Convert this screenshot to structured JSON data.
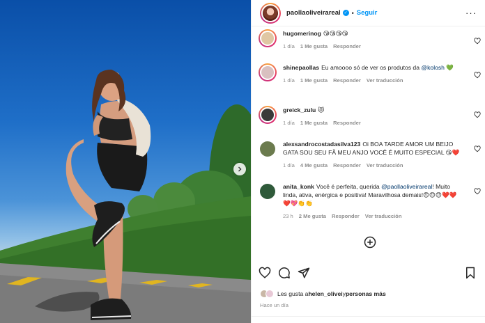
{
  "header": {
    "username": "paollaoliveirareal",
    "separator": "•",
    "follow_label": "Seguir",
    "more_label": "···"
  },
  "comments": [
    {
      "username": "hugomerinog",
      "text": "😘😘😘😘",
      "meta": [
        "1 día",
        "1 Me gusta",
        "Responder"
      ],
      "avatar_color": "#e0c7a3"
    },
    {
      "username": "shinepaollas",
      "text": "Eu amoooo só de ver os produtos da ",
      "mention": "@kolosh",
      "text_after": " 💚",
      "meta": [
        "1 día",
        "1 Me gusta",
        "Responder",
        "Ver traducción"
      ],
      "avatar_color": "#d9c0c0"
    },
    {
      "username": "greick_zulu",
      "text": "😻",
      "meta": [
        "1 día",
        "1 Me gusta",
        "Responder"
      ],
      "avatar_color": "#3a3a3a"
    },
    {
      "username": "alexsandrocostadasilva123",
      "text": "Oi BOA TARDE AMOR UM BEIJO GATA SOU SEU FÃ MEU ANJO VOCÊ É MUITO ESPECIAL 😘❤️",
      "meta": [
        "1 día",
        "4 Me gusta",
        "Responder",
        "Ver traducción"
      ],
      "avatar_color": "#6b7b4e"
    },
    {
      "username": "anita_konk",
      "text": "Você é perfeita, querida ",
      "mention": "@paollaoliveirareal",
      "text_after": "! Muito linda, ativa, enérgica e positiva! Maravilhosa demais!😍😍😍❤️❤️❤️💖👏👏",
      "meta": [
        "23 h",
        "2 Me gusta",
        "Responder",
        "Ver traducción"
      ],
      "avatar_color": "#2f5a3a"
    }
  ],
  "likes": {
    "prefix": "Les gusta a ",
    "user": "helen_olivei",
    "middle": " y ",
    "others": "personas más"
  },
  "time_ago": "Hace un día",
  "icons": {
    "carousel_next": "chevron-right-icon",
    "like": "heart-icon",
    "comment": "comment-icon",
    "share": "send-icon",
    "save": "bookmark-icon",
    "load_more": "plus-circle-icon"
  },
  "colors": {
    "accent": "#0095f6",
    "muted": "#8e8e8e",
    "mention": "#00376b"
  }
}
